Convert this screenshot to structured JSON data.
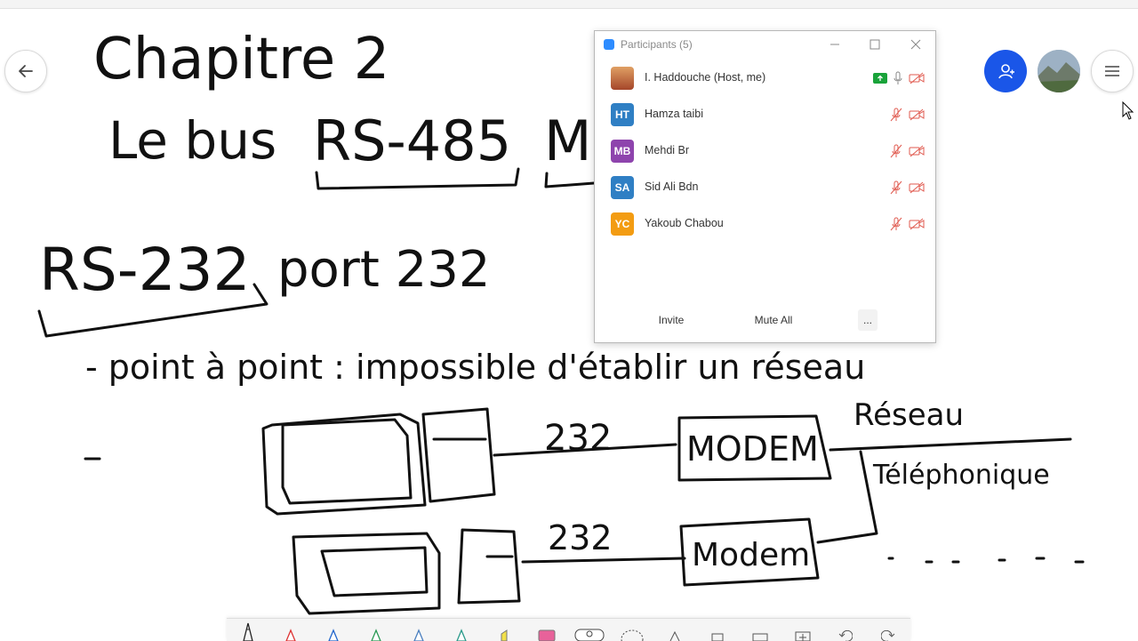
{
  "whiteboard": {
    "title": "Chapitre 2",
    "subtitle_prefix": "Le bus",
    "subtitle_bus": "RS-485",
    "subtitle_next": "M",
    "rs232": "RS-232",
    "port": "port 232",
    "bullet": "- point à point : impossible d'établir un réseau",
    "cable_label_1": "232",
    "cable_label_2": "232",
    "modem_1": "MODEM",
    "modem_2": "Modem",
    "network_1": "Réseau",
    "network_2": "Téléphonique"
  },
  "participants_panel": {
    "title": "Participants (5)",
    "participants": [
      {
        "name": "I. Haddouche (Host, me)",
        "initials": "",
        "color": "#c86a3a"
      },
      {
        "name": "Hamza taibi",
        "initials": "HT",
        "color": "#2f7fc4"
      },
      {
        "name": "Mehdi Br",
        "initials": "MB",
        "color": "#8e44ad"
      },
      {
        "name": "Sid Ali Bdn",
        "initials": "SA",
        "color": "#2f7fc4"
      },
      {
        "name": "Yakoub Chabou",
        "initials": "YC",
        "color": "#f39c12"
      }
    ],
    "invite_label": "Invite",
    "mute_all_label": "Mute All",
    "more_label": "..."
  },
  "colors": {
    "accent": "#1a56e8",
    "muted_icon": "#e05a4f",
    "share_green": "#19a33a"
  },
  "icons": {
    "back": "arrow-left-icon",
    "participants": "add-user-icon",
    "menu": "hamburger-icon"
  }
}
